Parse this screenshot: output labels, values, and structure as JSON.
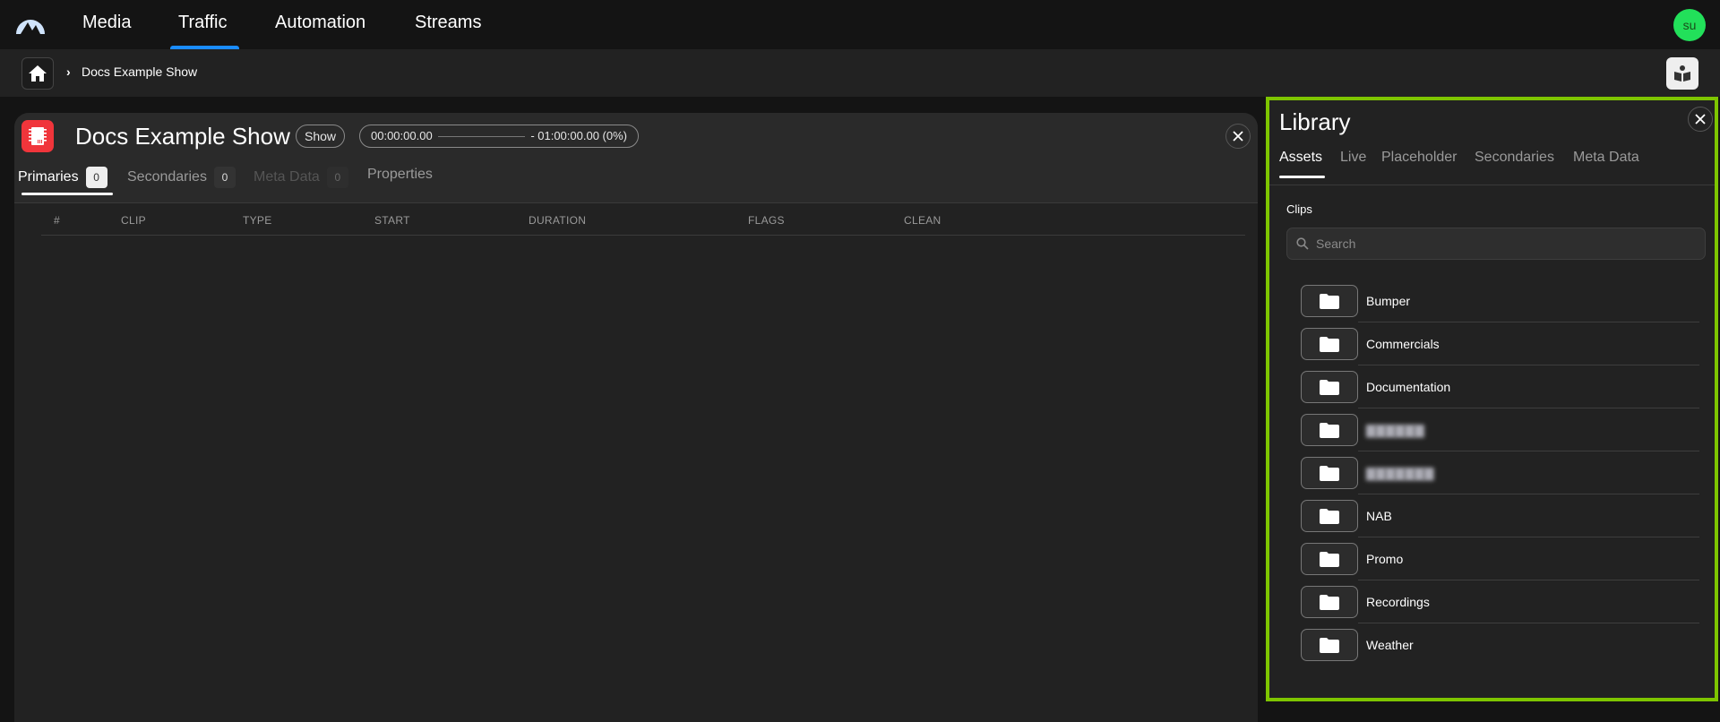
{
  "nav": {
    "items": [
      {
        "label": "Media",
        "active": false
      },
      {
        "label": "Traffic",
        "active": true
      },
      {
        "label": "Automation",
        "active": false
      },
      {
        "label": "Streams",
        "active": false
      }
    ],
    "accent_color": "#1a8cff",
    "avatar_initials": "su",
    "avatar_color": "#22e05a"
  },
  "breadcrumb": {
    "home_icon": "home-icon",
    "separator": "›",
    "items": [
      "Docs Example Show"
    ],
    "library_toggle_icon": "book-reader-icon"
  },
  "show": {
    "icon": "chip-icon",
    "icon_color": "#f0353b",
    "title": "Docs Example Show",
    "type_badge": "Show",
    "time_start": "00:00:00.00",
    "time_end": "- 01:00:00.00 (0%)",
    "progress_percent": 0,
    "tabs": [
      {
        "label": "Primaries",
        "count": "0",
        "state": "active"
      },
      {
        "label": "Secondaries",
        "count": "0",
        "state": "normal"
      },
      {
        "label": "Meta Data",
        "count": "0",
        "state": "disabled"
      },
      {
        "label": "Properties",
        "count": null,
        "state": "normal"
      }
    ],
    "table": {
      "columns": [
        "#",
        "CLIP",
        "TYPE",
        "START",
        "DURATION",
        "FLAGS",
        "CLEAN"
      ],
      "rows": []
    }
  },
  "library": {
    "title": "Library",
    "highlight_color": "#7ec500",
    "tabs": [
      {
        "label": "Assets",
        "active": true
      },
      {
        "label": "Live",
        "active": false
      },
      {
        "label": "Placeholder",
        "active": false
      },
      {
        "label": "Secondaries",
        "active": false
      },
      {
        "label": "Meta Data",
        "active": false
      }
    ],
    "section_label": "Clips",
    "search": {
      "placeholder": "Search",
      "value": ""
    },
    "folders": [
      {
        "name": "Bumper",
        "redacted": false
      },
      {
        "name": "Commercials",
        "redacted": false
      },
      {
        "name": "Documentation",
        "redacted": false
      },
      {
        "name": "▇▇▇▇▇▇",
        "redacted": true
      },
      {
        "name": "▇▇▇▇▇▇▇",
        "redacted": true
      },
      {
        "name": "NAB",
        "redacted": false
      },
      {
        "name": "Promo",
        "redacted": false
      },
      {
        "name": "Recordings",
        "redacted": false
      },
      {
        "name": "Weather",
        "redacted": false
      }
    ]
  }
}
